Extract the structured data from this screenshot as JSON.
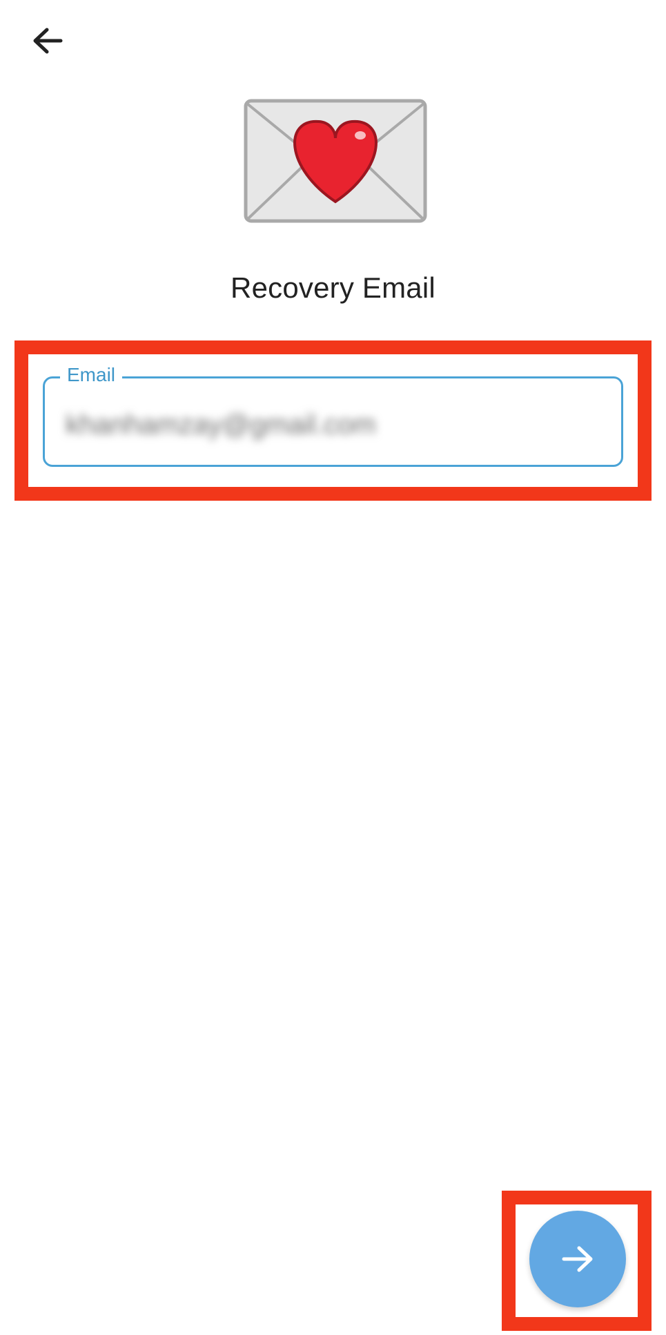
{
  "header": {
    "back_icon": "arrow-left-icon"
  },
  "hero": {
    "icon": "envelope-heart-icon"
  },
  "page": {
    "title": "Recovery Email"
  },
  "email_field": {
    "label": "Email",
    "value": "khanhamzay@gmail.com",
    "accent_color": "#4aa3d6"
  },
  "next_button": {
    "icon": "arrow-right-icon",
    "color": "#62a8e3"
  },
  "annotations": {
    "highlight_color": "#f2371a"
  }
}
